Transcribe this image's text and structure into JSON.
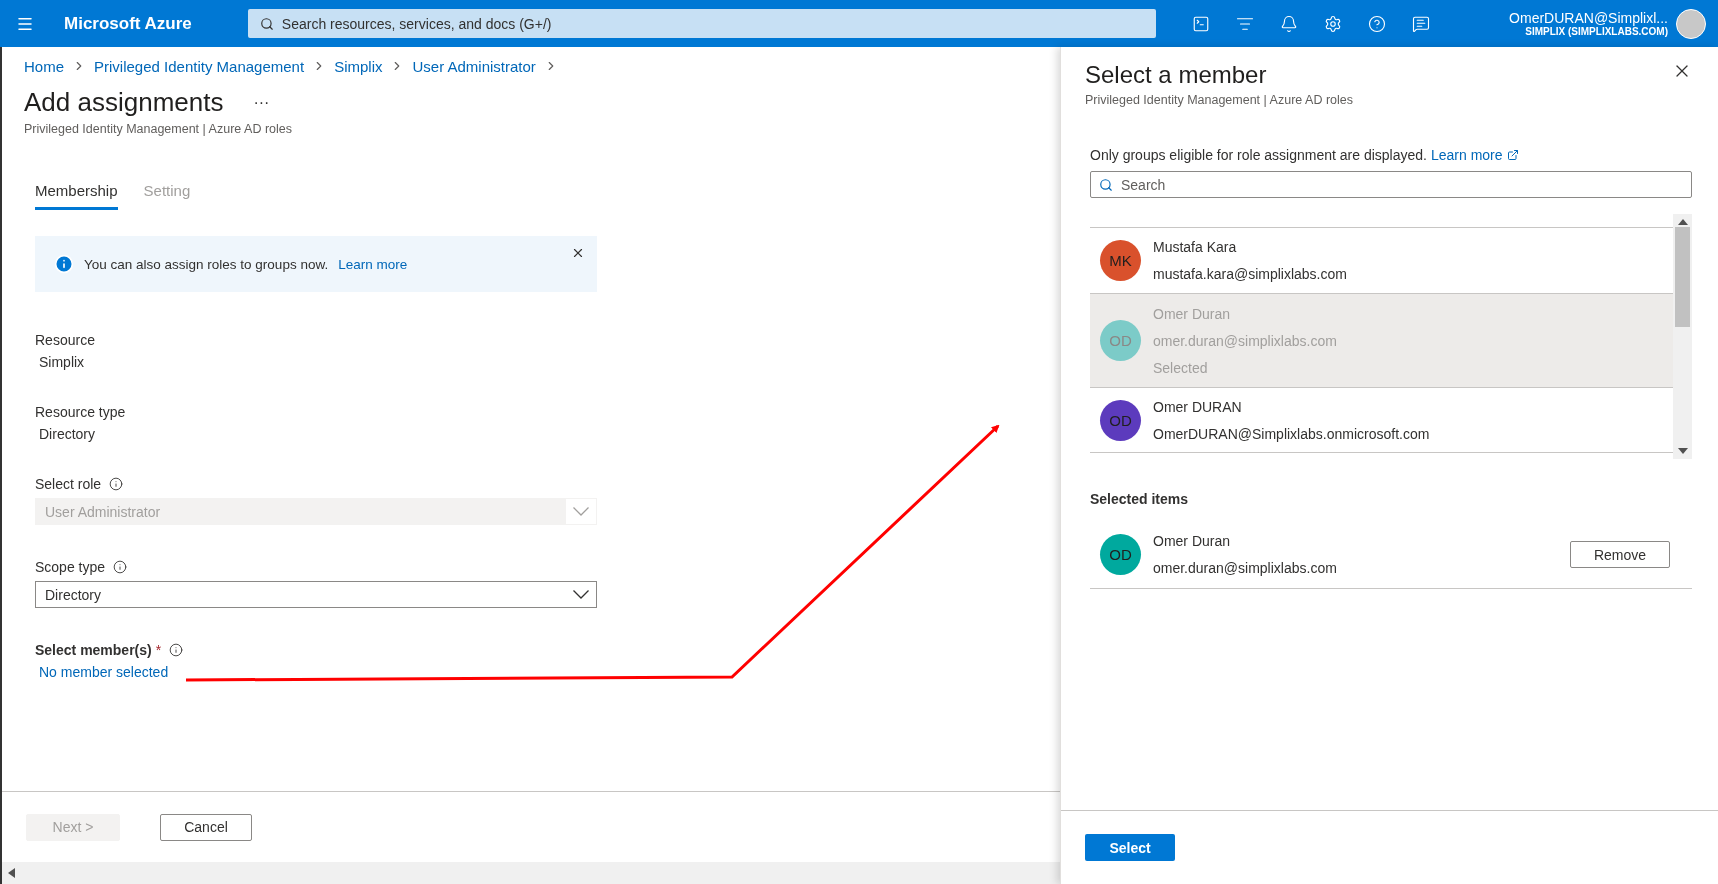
{
  "topbar": {
    "brand": "Microsoft Azure",
    "search": {
      "placeholder": "Search resources, services, and docs (G+/)"
    },
    "account": {
      "name": "OmerDURAN@Simplixl...",
      "tenant": "SIMPLIX (SIMPLIXLABS.COM)"
    }
  },
  "breadcrumb": [
    "Home",
    "Privileged Identity Management",
    "Simplix",
    "User Administrator"
  ],
  "page": {
    "title": "Add assignments",
    "more": "···",
    "subtitle": "Privileged Identity Management | Azure AD roles",
    "tabs": [
      {
        "label": "Membership",
        "selected": true
      },
      {
        "label": "Setting",
        "selected": false
      }
    ],
    "info_bar": {
      "text": "You can also assign roles to groups now.",
      "link": "Learn more"
    },
    "fields": [
      {
        "kind": "static",
        "label": "Resource",
        "value": "Simplix"
      },
      {
        "kind": "static",
        "label": "Resource type",
        "value": "Directory"
      },
      {
        "kind": "dropdown",
        "label": "Select role",
        "info": true,
        "value": "User Administrator",
        "disabled": true
      },
      {
        "kind": "dropdown",
        "label": "Scope type",
        "info": true,
        "value": "Directory",
        "disabled": false
      },
      {
        "kind": "link",
        "label": "Select member(s)",
        "required_mark": "*",
        "info": true,
        "value": "No member selected"
      }
    ],
    "buttons": [
      {
        "label": "Next >",
        "disabled": true
      },
      {
        "label": "Cancel",
        "disabled": false
      }
    ]
  },
  "panel": {
    "title": "Select a member",
    "subtitle": "Privileged Identity Management | Azure AD roles",
    "notice": {
      "text": "Only groups eligible for role assignment are displayed.",
      "link": "Learn more"
    },
    "search": {
      "placeholder": "Search"
    },
    "members": [
      {
        "initials": "MK",
        "name": "Mustafa Kara",
        "email": "mustafa.kara@simplixlabs.com",
        "color": "#d9512c",
        "selected": false
      },
      {
        "initials": "OD",
        "name": "Omer Duran",
        "email": "omer.duran@simplixlabs.com",
        "status": "Selected",
        "color": "#7ccbc8",
        "selected": true
      },
      {
        "initials": "OD",
        "name": "Omer DURAN",
        "email": "OmerDURAN@Simplixlabs.onmicrosoft.com",
        "color": "#5c3bbd",
        "selected": false
      }
    ],
    "selected_heading": "Selected items",
    "selected_items": [
      {
        "initials": "OD",
        "name": "Omer Duran",
        "email": "omer.duran@simplixlabs.com",
        "color": "#00a99e",
        "action": "Remove"
      }
    ],
    "primary_button": "Select"
  }
}
